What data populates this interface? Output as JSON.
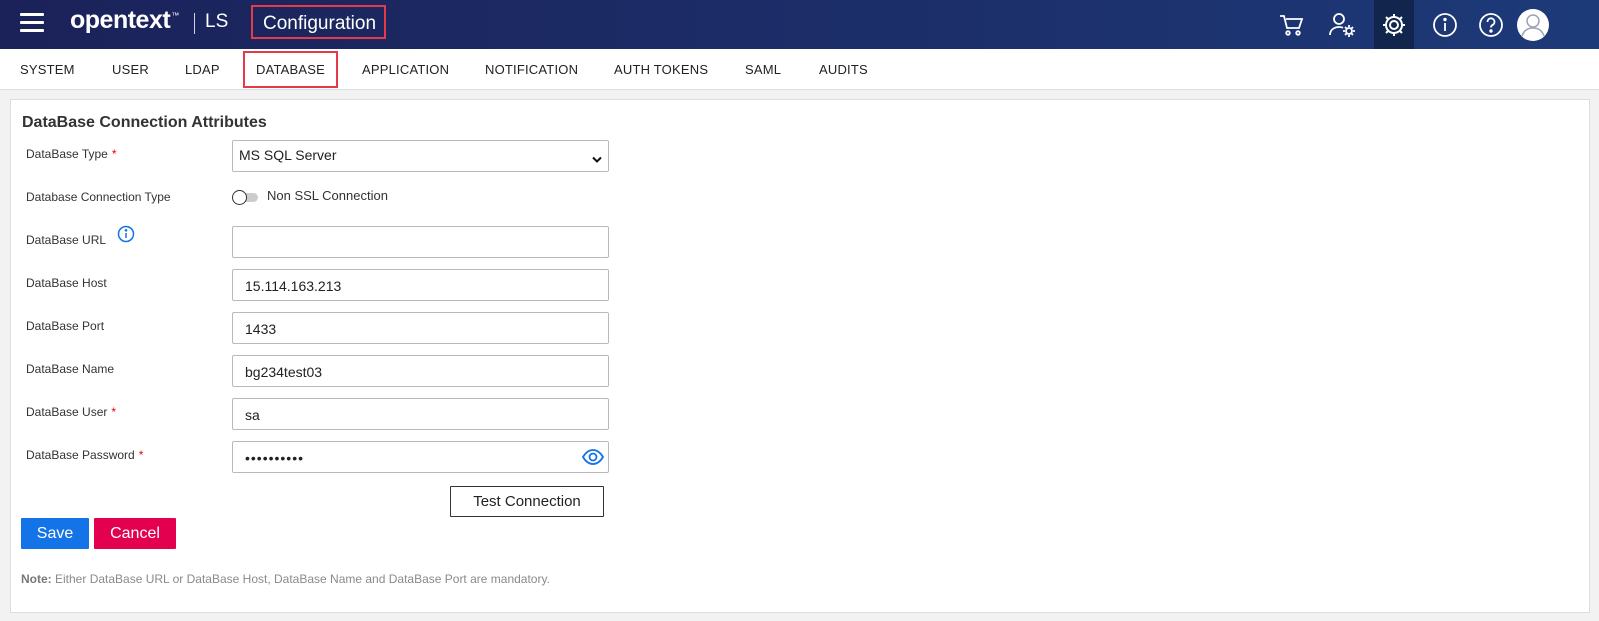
{
  "header": {
    "brand": "opentext",
    "brand_tm": "™",
    "product": "LS",
    "page_title": "Configuration",
    "icons": [
      "shopping-cart-icon",
      "user-settings-icon",
      "gear-icon",
      "info-icon",
      "help-icon",
      "user-avatar-icon"
    ]
  },
  "tabs": [
    {
      "label": "SYSTEM"
    },
    {
      "label": "USER"
    },
    {
      "label": "LDAP"
    },
    {
      "label": "DATABASE"
    },
    {
      "label": "APPLICATION"
    },
    {
      "label": "NOTIFICATION"
    },
    {
      "label": "AUTH TOKENS"
    },
    {
      "label": "SAML"
    },
    {
      "label": "AUDITS"
    }
  ],
  "active_tab": "DATABASE",
  "form": {
    "title": "DataBase Connection Attributes",
    "db_type": {
      "label": "DataBase Type",
      "value": "MS SQL Server",
      "required_mark": "*"
    },
    "conn_type": {
      "label": "Database Connection Type",
      "toggle_label": "Non SSL Connection",
      "on": false
    },
    "db_url": {
      "label": "DataBase URL",
      "value": ""
    },
    "db_host": {
      "label": "DataBase Host",
      "value": "15.114.163.213"
    },
    "db_port": {
      "label": "DataBase Port",
      "value": "1433"
    },
    "db_name": {
      "label": "DataBase Name",
      "value": "bg234test03"
    },
    "db_user": {
      "label": "DataBase User",
      "value": "sa",
      "required_mark": "*"
    },
    "db_password": {
      "label": "DataBase Password",
      "value": "••••••••••",
      "required_mark": "*"
    },
    "test_button": "Test Connection",
    "save_button": "Save",
    "cancel_button": "Cancel",
    "note_prefix": "Note:",
    "note_text": " Either DataBase URL or DataBase Host, DataBase Name and DataBase Port are mandatory."
  },
  "colors": {
    "header_bg": "#1c2f6b",
    "highlight_border": "#e63a4a",
    "save": "#1473e6",
    "cancel": "#e3004f",
    "info_blue": "#1473e6"
  }
}
